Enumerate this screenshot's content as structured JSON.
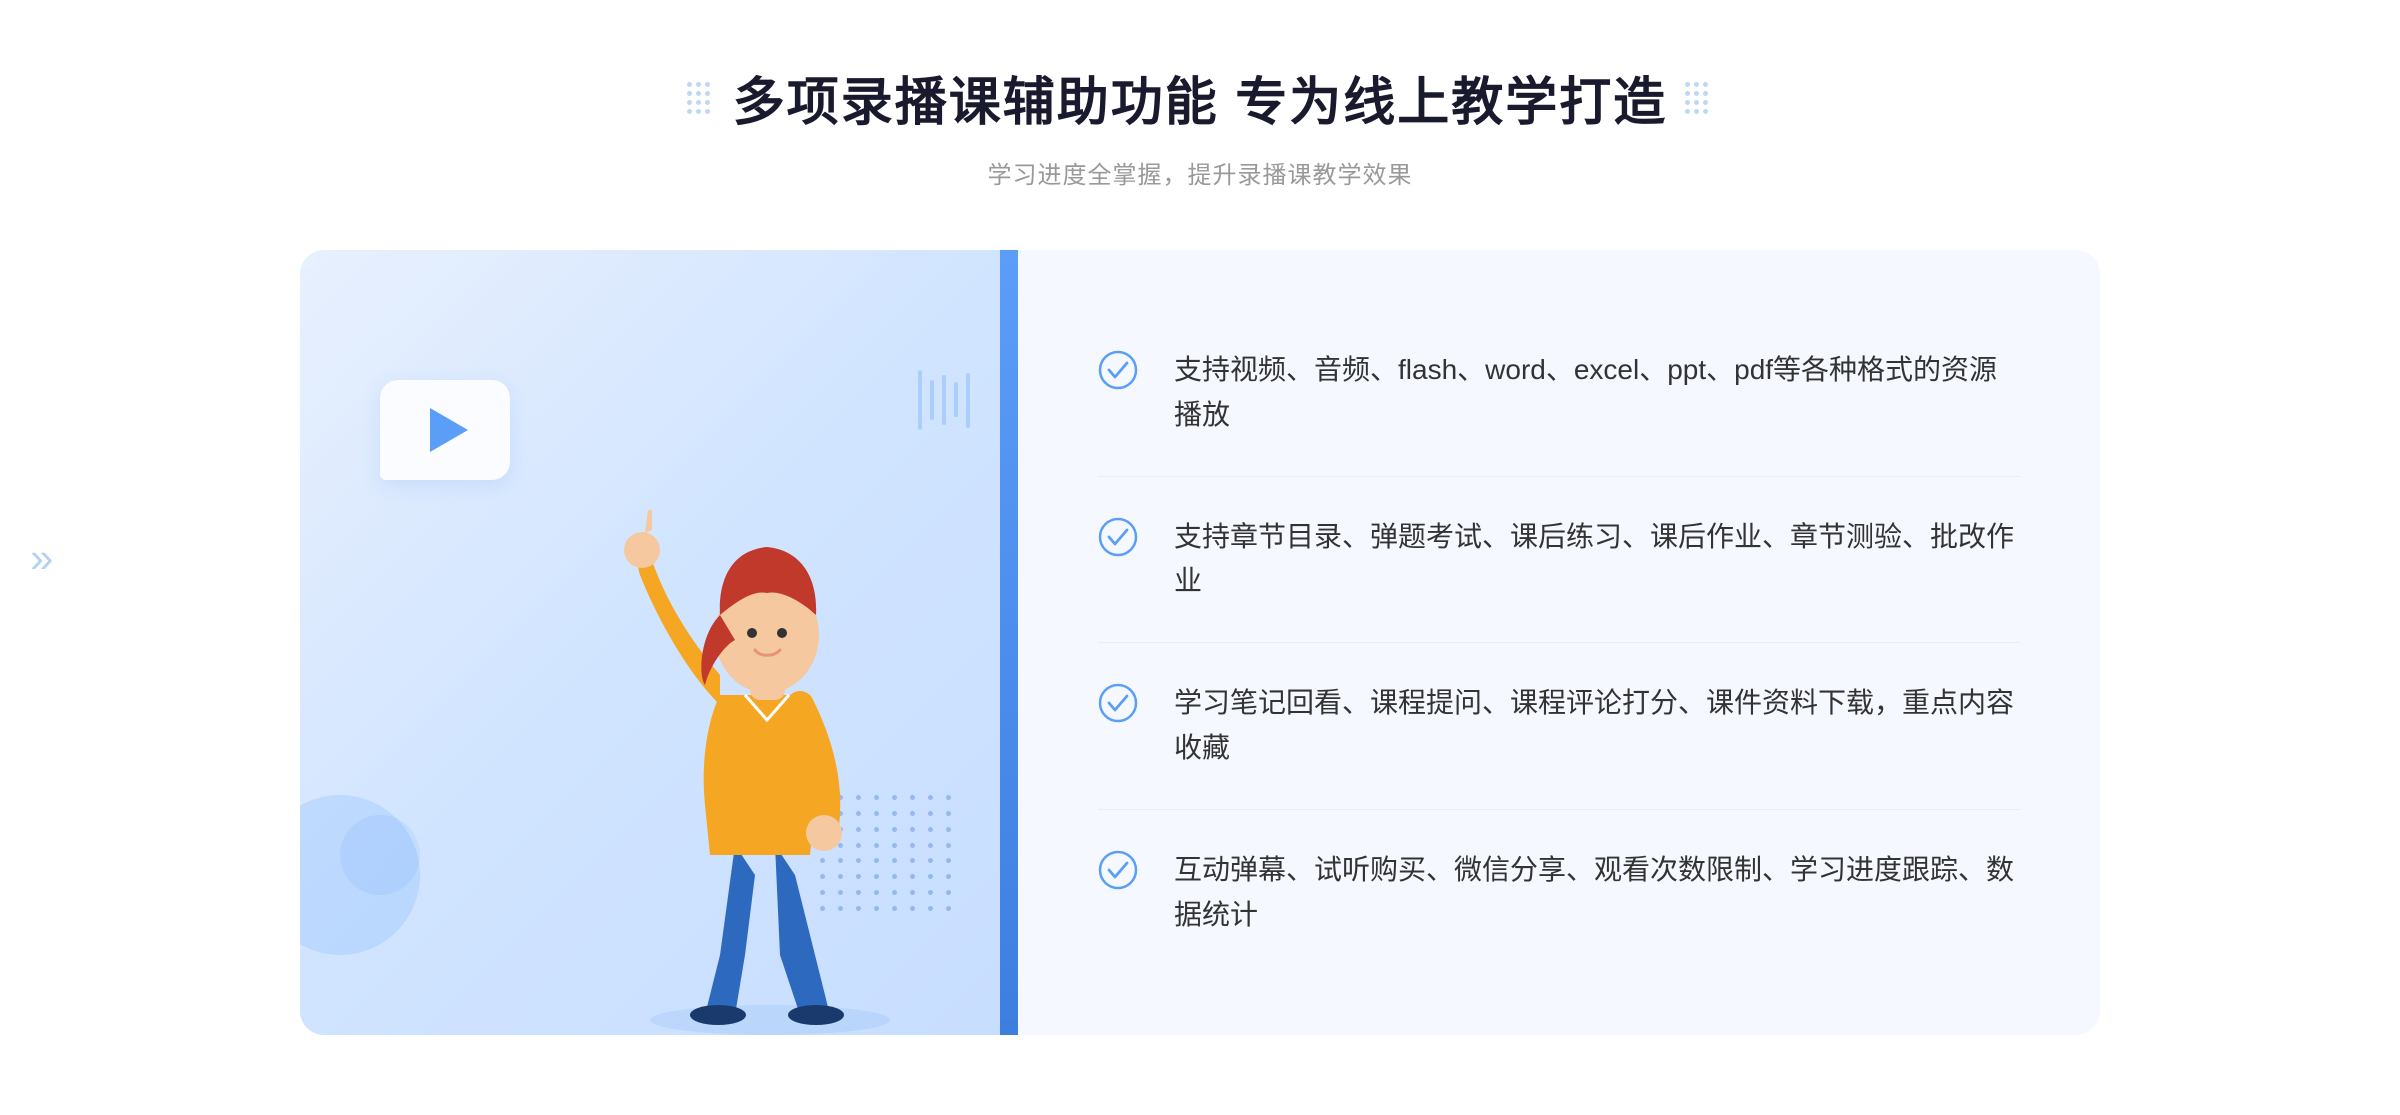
{
  "header": {
    "title": "多项录播课辅助功能 专为线上教学打造",
    "subtitle": "学习进度全掌握，提升录播课教学效果",
    "deco_dots_count": 12
  },
  "features": [
    {
      "id": 1,
      "text": "支持视频、音频、flash、word、excel、ppt、pdf等各种格式的资源播放"
    },
    {
      "id": 2,
      "text": "支持章节目录、弹题考试、课后练习、课后作业、章节测验、批改作业"
    },
    {
      "id": 3,
      "text": "学习笔记回看、课程提问、课程评论打分、课件资料下载，重点内容收藏"
    },
    {
      "id": 4,
      "text": "互动弹幕、试听购买、微信分享、观看次数限制、学习进度跟踪、数据统计"
    }
  ],
  "colors": {
    "accent_blue": "#5b9ef8",
    "dark_blue": "#3d7edf",
    "light_bg": "#f5f9ff",
    "title_color": "#1a1a2e",
    "text_color": "#333333",
    "subtitle_color": "#999999"
  }
}
